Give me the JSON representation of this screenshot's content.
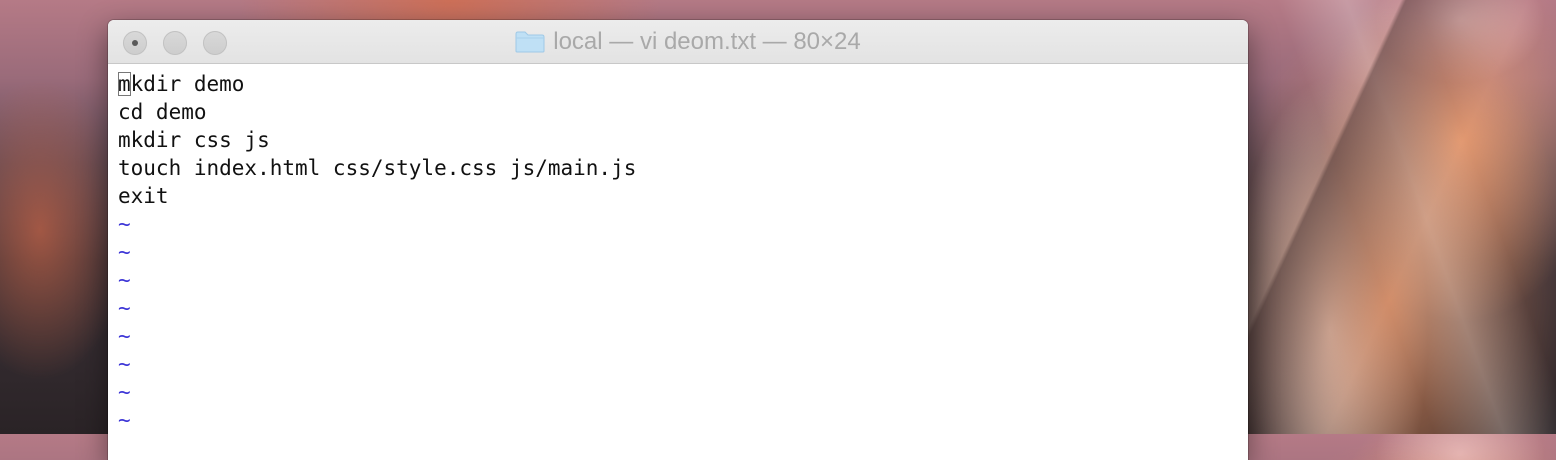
{
  "window": {
    "title": "local — vi deom.txt — 80×24"
  },
  "buffer": {
    "lines": [
      "mkdir demo",
      "cd demo",
      "mkdir css js",
      "touch index.html css/style.css js/main.js",
      "exit"
    ],
    "cursor_char": "m",
    "first_line_rest": "kdir demo",
    "empty_marker": "~",
    "empty_line_count": 8
  },
  "colors": {
    "tilde": "#3c35d6",
    "folder": "#bfe0f5",
    "title_text": "#a9a9a9"
  },
  "icons": {
    "close": "close-dot-icon",
    "minimize": "minimize-button-icon",
    "zoom": "zoom-button-icon",
    "title": "folder-icon"
  }
}
